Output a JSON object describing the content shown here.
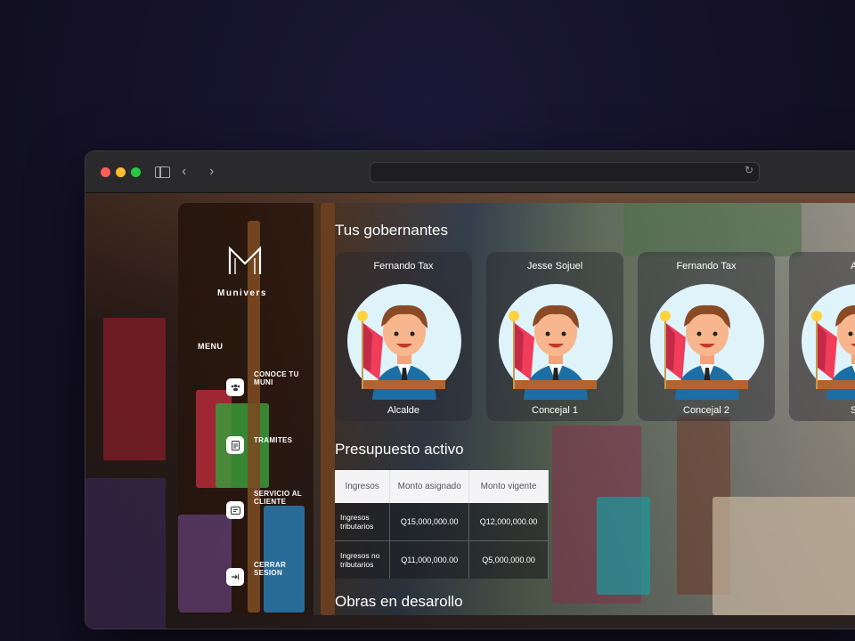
{
  "browser": {
    "url": "",
    "controls": {
      "back": "‹",
      "forward": "›",
      "reload": "↻"
    }
  },
  "app": {
    "brand": "Munivers",
    "menu_title": "MENU",
    "menu": [
      {
        "label": "CONOCE TU MUNI",
        "icon": "people-icon"
      },
      {
        "label": "TRAMITES",
        "icon": "document-icon"
      },
      {
        "label": "SERVICIO AL CLIENTE",
        "icon": "support-icon"
      },
      {
        "label": "CERRAR SESION",
        "icon": "logout-icon"
      }
    ],
    "governors_title": "Tus gobernantes",
    "governors": [
      {
        "name": "Fernando Tax",
        "role": "Alcalde"
      },
      {
        "name": "Jesse Sojuel",
        "role": "Concejal 1"
      },
      {
        "name": "Fernando Tax",
        "role": "Concejal 2"
      },
      {
        "name": "Ale",
        "role": "Sin"
      }
    ],
    "budget_title": "Presupuesto activo",
    "budget": {
      "headers": [
        "Ingresos",
        "Monto asignado",
        "Monto vigente"
      ],
      "rows": [
        [
          "Ingresos tributarios",
          "Q15,000,000.00",
          "Q12,000,000.00"
        ],
        [
          "Ingresos no tributarios",
          "Q11,000,000.00",
          "Q5,000,000.00"
        ]
      ]
    },
    "works_title": "Obras en desarollo"
  },
  "colors": {
    "page_bg": "#151228",
    "traffic_red": "#ff5f57",
    "traffic_yellow": "#febc2e",
    "traffic_green": "#28c840",
    "avatar_circle": "#dff3fb",
    "flag_red": "#ef3d5a",
    "suit_blue": "#1e6ea6"
  }
}
